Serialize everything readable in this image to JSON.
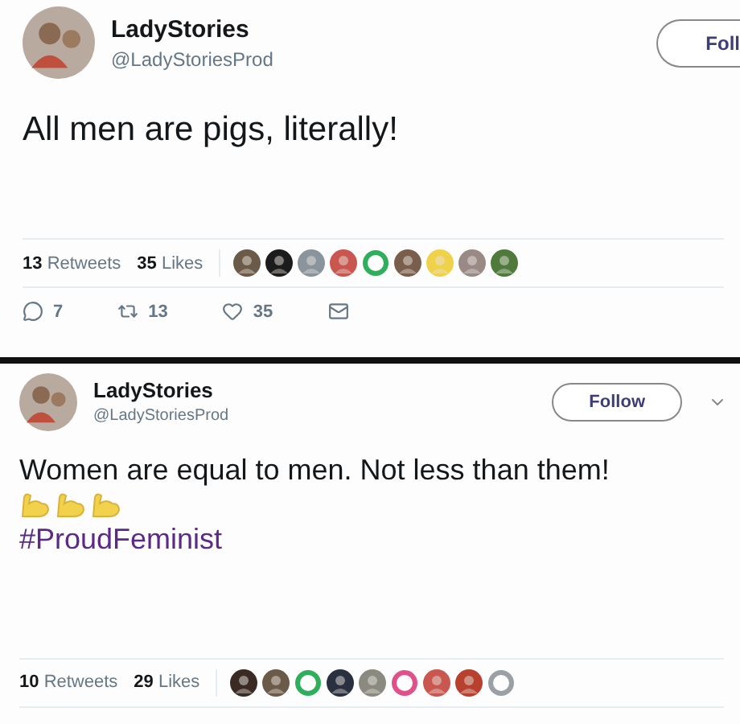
{
  "tweets": [
    {
      "name": "LadyStories",
      "handle": "@LadyStoriesProd",
      "follow": "Foll",
      "follow_cut": true,
      "text": "All men are pigs, literally!",
      "retweets": {
        "count": "13",
        "label": "Retweets"
      },
      "likes": {
        "count": "35",
        "label": "Likes"
      },
      "likers": [
        {
          "kind": "photo",
          "color": "#6b5a48"
        },
        {
          "kind": "photo",
          "color": "#1c1c1c"
        },
        {
          "kind": "photo",
          "color": "#8a949c"
        },
        {
          "kind": "photo",
          "color": "#c9574f"
        },
        {
          "kind": "ring",
          "color": "#2fae5c"
        },
        {
          "kind": "photo",
          "color": "#7a5e4c"
        },
        {
          "kind": "photo",
          "color": "#f0d24a"
        },
        {
          "kind": "photo",
          "color": "#9a8a86"
        },
        {
          "kind": "photo",
          "color": "#4f7a3c"
        }
      ],
      "actions": [
        {
          "kind": "reply",
          "count": "7"
        },
        {
          "kind": "retweet",
          "count": "13"
        },
        {
          "kind": "like",
          "count": "35"
        },
        {
          "kind": "message"
        }
      ]
    },
    {
      "name": "LadyStories",
      "handle": "@LadyStoriesProd",
      "follow": "Follow",
      "follow_cut": false,
      "menu": true,
      "text": "Women are equal to men. Not less than them!",
      "emoji": [
        {
          "kind": "biceps"
        },
        {
          "kind": "biceps"
        },
        {
          "kind": "biceps"
        }
      ],
      "hashtag": "#ProudFeminist",
      "retweets": {
        "count": "10",
        "label": "Retweets"
      },
      "likes": {
        "count": "29",
        "label": "Likes"
      },
      "likers": [
        {
          "kind": "photo",
          "color": "#3a2a24"
        },
        {
          "kind": "photo",
          "color": "#6b5a48"
        },
        {
          "kind": "ring",
          "color": "#2fae5c"
        },
        {
          "kind": "photo",
          "color": "#2a3040"
        },
        {
          "kind": "photo",
          "color": "#8a8a80"
        },
        {
          "kind": "ring",
          "color": "#e0508a"
        },
        {
          "kind": "photo",
          "color": "#c9574f"
        },
        {
          "kind": "photo",
          "color": "#b8402e"
        },
        {
          "kind": "ring",
          "color": "#9aa0a6"
        }
      ]
    }
  ]
}
